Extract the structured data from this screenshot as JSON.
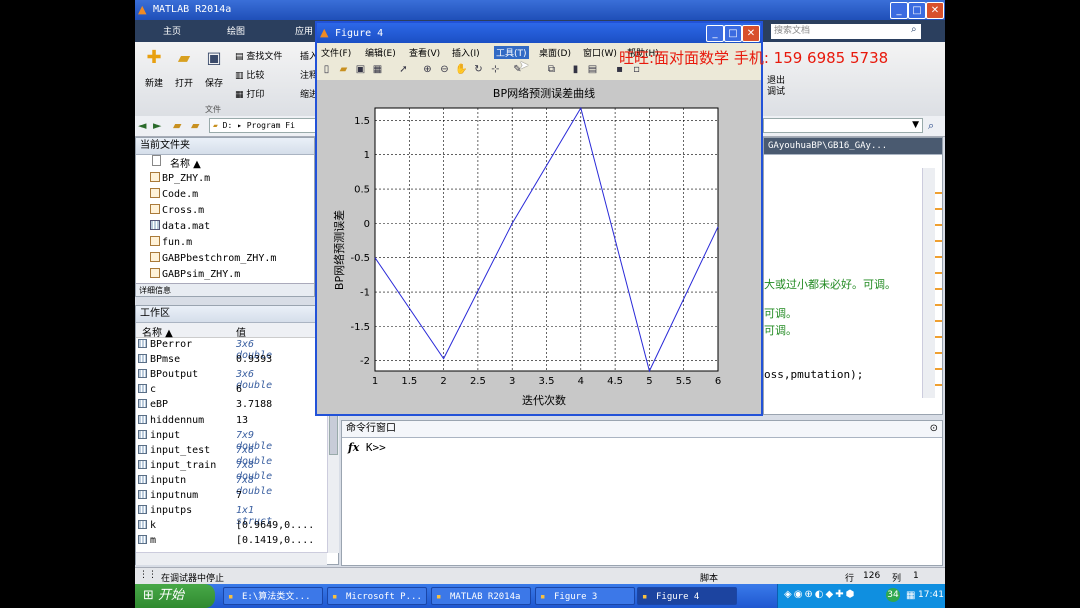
{
  "matlab": {
    "title": "MATLAB R2014a",
    "tabs": [
      "主页",
      "绘图",
      "应用"
    ],
    "search_placeholder": "搜索文档",
    "ribbon": {
      "new": "新建",
      "open": "打开",
      "save": "保存",
      "find_files": "查找文件",
      "compare": "比较",
      "print": "打印",
      "insert": "插入",
      "comment": "注释",
      "indent": "缩进",
      "file_group": "文件",
      "exit_debug": "退出\n调试"
    },
    "address": [
      "D:",
      "Program Fi"
    ],
    "editor_path": "GAyouhuaBP\\GB16_GAy..."
  },
  "current_folder": {
    "title": "当前文件夹",
    "name_col": "名称 ▲",
    "files": [
      "BP_ZHY.m",
      "Code.m",
      "Cross.m",
      "data.mat",
      "fun.m",
      "GABPbestchrom_ZHY.m",
      "GABPsim_ZHY.m"
    ],
    "details": "详细信息"
  },
  "workspace": {
    "title": "工作区",
    "col_name": "名称 ▲",
    "col_value": "值",
    "vars": [
      {
        "name": "BPerror",
        "value": "3x6 double",
        "italic": true
      },
      {
        "name": "BPmse",
        "value": "0.9393",
        "italic": false
      },
      {
        "name": "BPoutput",
        "value": "3x6 double",
        "italic": true
      },
      {
        "name": "c",
        "value": "6",
        "italic": false
      },
      {
        "name": "eBP",
        "value": "3.7188",
        "italic": false
      },
      {
        "name": "hiddennum",
        "value": "13",
        "italic": false
      },
      {
        "name": "input",
        "value": "7x9 double",
        "italic": true
      },
      {
        "name": "input_test",
        "value": "7x6 double",
        "italic": true
      },
      {
        "name": "input_train",
        "value": "7x8 double",
        "italic": true
      },
      {
        "name": "inputn",
        "value": "7x8 double",
        "italic": true
      },
      {
        "name": "inputnum",
        "value": "7",
        "italic": false
      },
      {
        "name": "inputps",
        "value": "1x1 struct",
        "italic": true
      },
      {
        "name": "k",
        "value": "[0.9649,0....",
        "italic": false
      },
      {
        "name": "m",
        "value": "[0.1419,0....",
        "italic": false
      }
    ]
  },
  "editor": {
    "lines": [
      "大或过小都未必好。可调。",
      "可调。",
      "可调。",
      "oss,pmutation);"
    ]
  },
  "command_window": {
    "title": "命令行窗口",
    "prompt": "K>>",
    "fx": "fx"
  },
  "figure": {
    "title": "Figure 4",
    "menu": [
      "文件(F)",
      "编辑(E)",
      "查看(V)",
      "插入(I)",
      "工具(T)",
      "桌面(D)",
      "窗口(W)",
      "帮助(H)"
    ]
  },
  "watermark": "旺旺:面对面数学 手机: 159 6985 5738",
  "status": {
    "left": "在调试器中停止",
    "script": "脚本",
    "row_label": "行",
    "row": "126",
    "col_label": "列",
    "col": "1"
  },
  "taskbar": {
    "start": "开始",
    "tasks": [
      "E:\\算法类文...",
      "Microsoft P...",
      "MATLAB R2014a",
      "Figure 3",
      "Figure 4"
    ],
    "active": 4,
    "time": "17:41",
    "badge": "34"
  },
  "colors": {
    "line": "#2a2ad8",
    "title_bar": "#2252d8",
    "watermark": "#e8190c"
  },
  "chart_data": {
    "type": "line",
    "title": "BP网络预测误差曲线",
    "xlabel": "迭代次数",
    "ylabel": "BP网络预测误差",
    "x": [
      1,
      2,
      3,
      4,
      5,
      6
    ],
    "series": [
      {
        "values": [
          -0.5,
          -1.97,
          0.0,
          1.68,
          -2.15,
          -0.05
        ]
      }
    ],
    "xlim": [
      1,
      6
    ],
    "ylim": [
      -2.15,
      1.68
    ],
    "xticks": [
      "1",
      "1.5",
      "2",
      "2.5",
      "3",
      "3.5",
      "4",
      "4.5",
      "5",
      "5.5",
      "6"
    ],
    "yticks": [
      "-2",
      "-1.5",
      "-1",
      "-0.5",
      "0",
      "0.5",
      "1",
      "1.5"
    ],
    "grid": true
  }
}
